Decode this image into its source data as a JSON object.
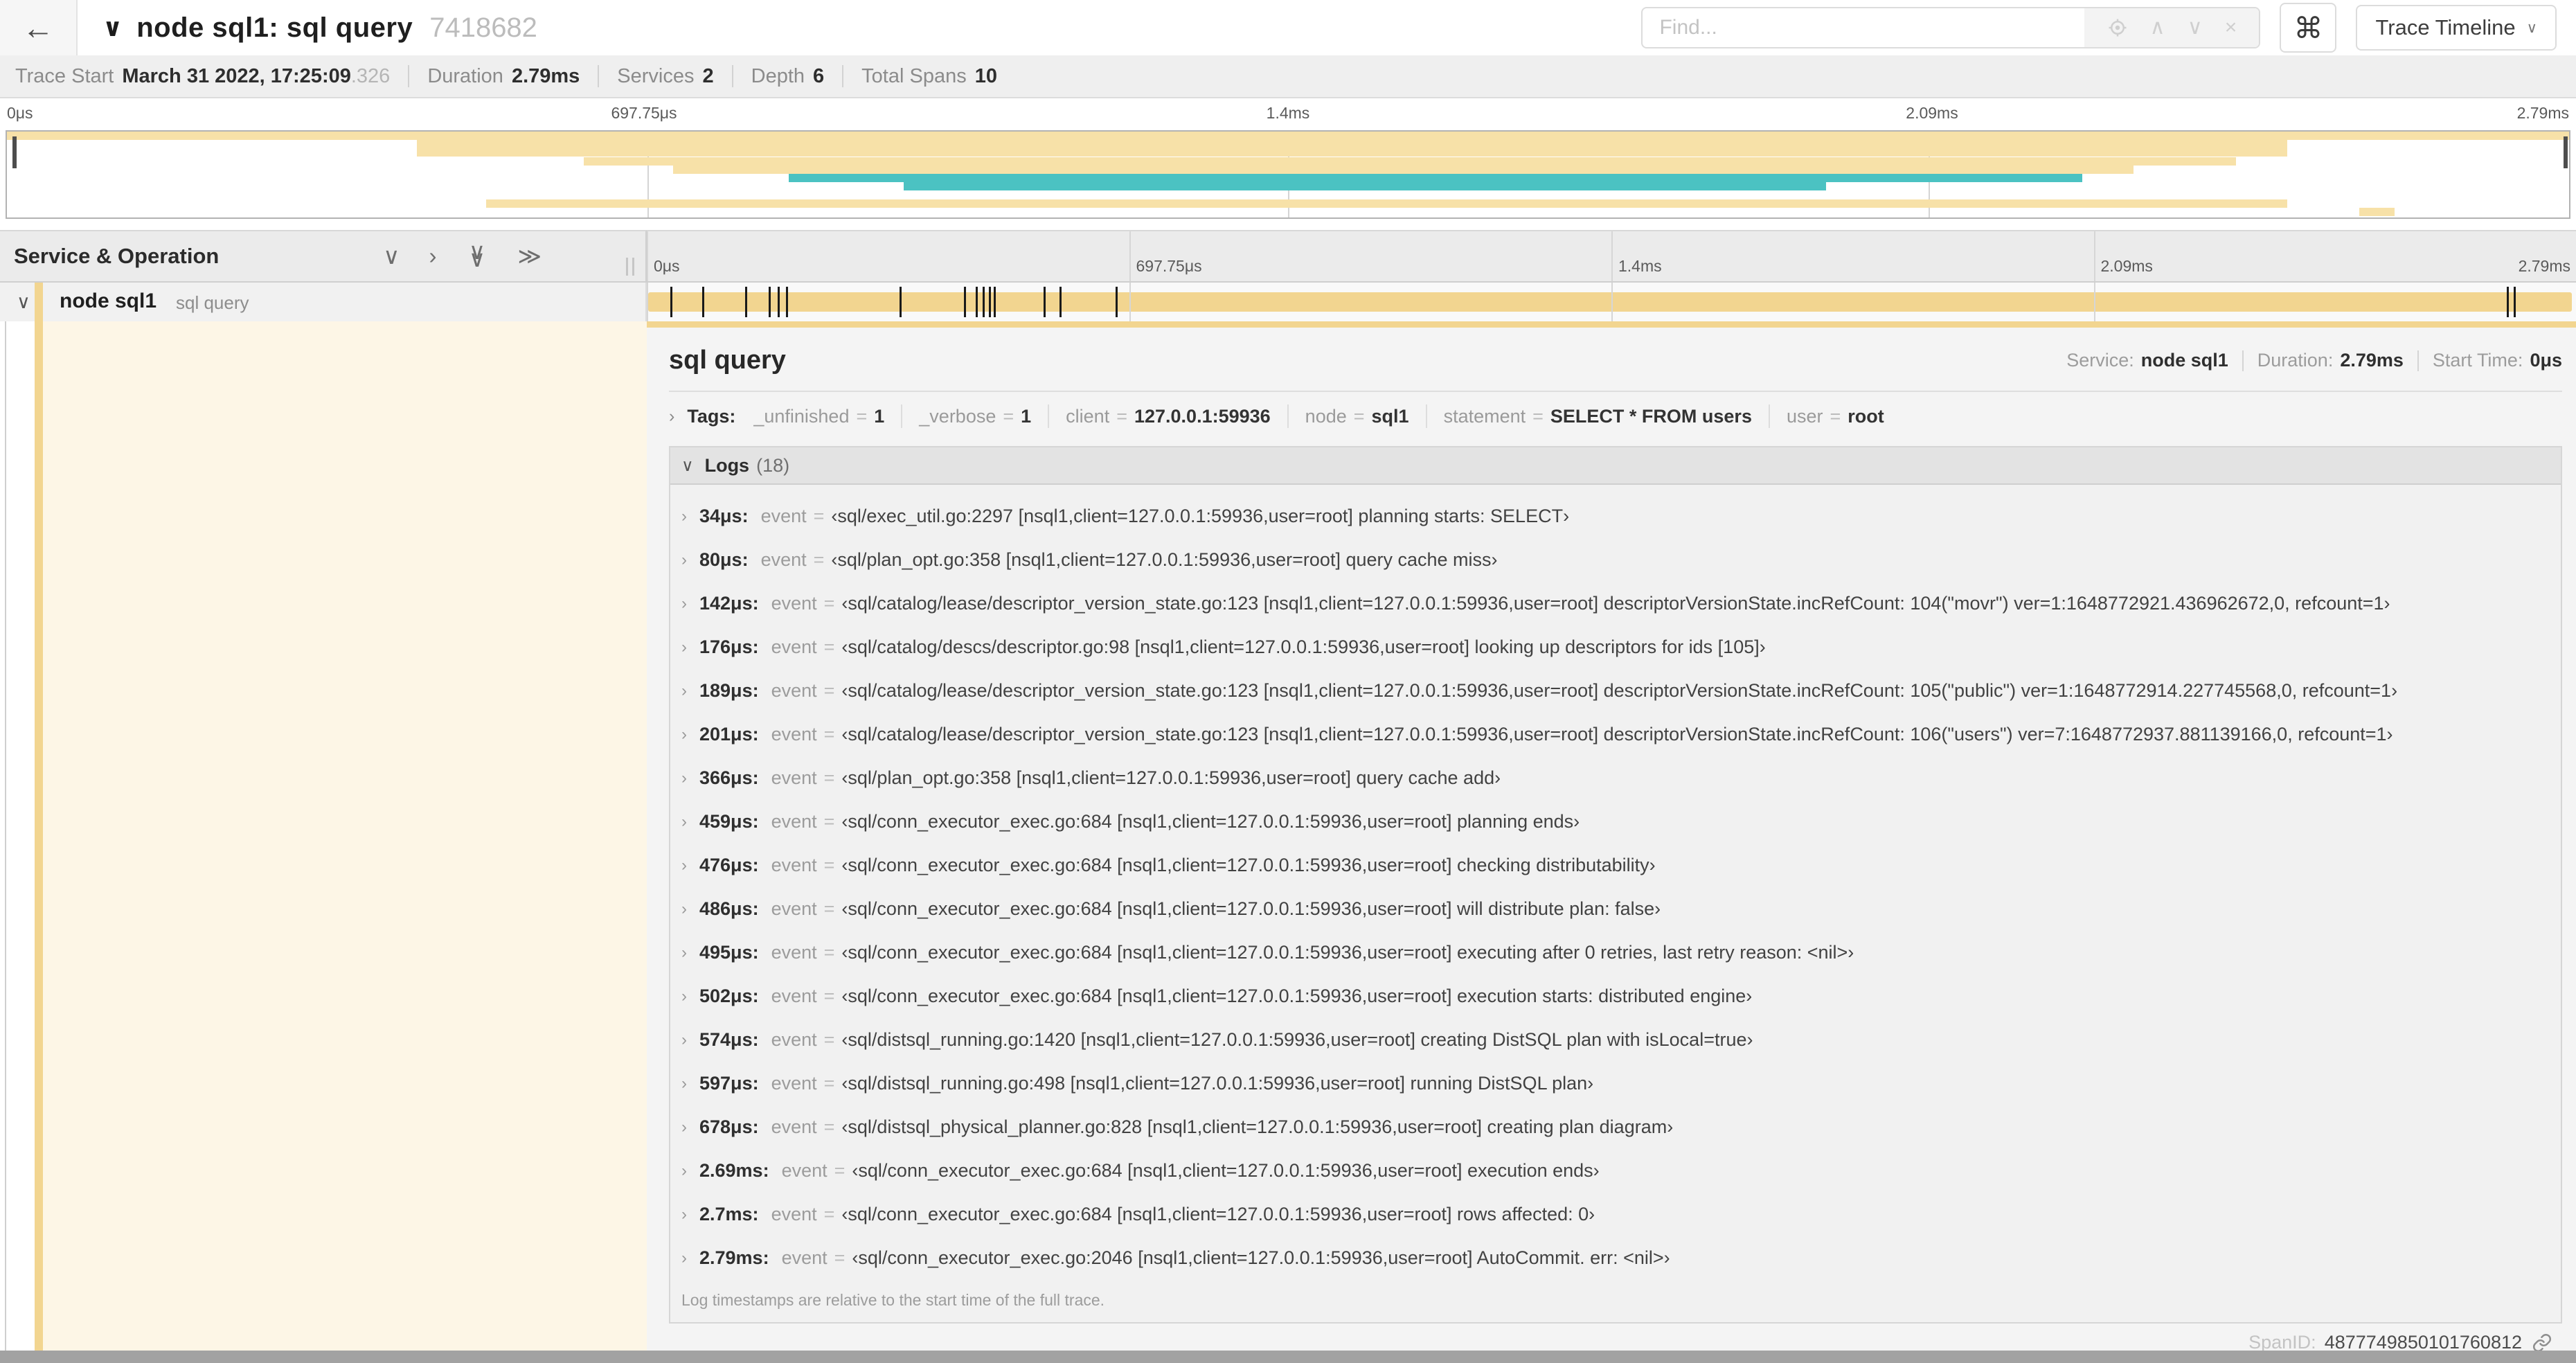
{
  "icons": {
    "back": "←",
    "chevron_down": "∨",
    "chevron_right": "›",
    "double_chevron_right": "≫",
    "chevron_up": "∧",
    "close": "×",
    "command": "⌘"
  },
  "topbar": {
    "title": "node sql1: sql query",
    "trace_id": "7418682",
    "find_placeholder": "Find...",
    "view_button": "Trace Timeline"
  },
  "trace_info": {
    "items": [
      {
        "label": "Trace Start",
        "value": "March 31 2022, 17:25:09",
        "muted": ".326"
      },
      {
        "label": "Duration",
        "value": "2.79ms"
      },
      {
        "label": "Services",
        "value": "2"
      },
      {
        "label": "Depth",
        "value": "6"
      },
      {
        "label": "Total Spans",
        "value": "10"
      }
    ]
  },
  "ruler": {
    "ticks": [
      "0μs",
      "697.75μs",
      "1.4ms",
      "2.09ms",
      "2.79ms"
    ]
  },
  "colors": {
    "tan": "#f2d590",
    "tan_light": "#f7e1a8",
    "teal": "#4bc2c2",
    "cream": "#fdf6e6"
  },
  "minimap": {
    "spans": [
      {
        "row": 0,
        "start": 0,
        "end": 100,
        "color": "tan_light"
      },
      {
        "row": 1,
        "start": 16,
        "end": 89,
        "color": "tan_light"
      },
      {
        "row": 2,
        "start": 16,
        "end": 89,
        "color": "tan_light"
      },
      {
        "row": 3,
        "start": 22.5,
        "end": 87,
        "color": "tan_light"
      },
      {
        "row": 4,
        "start": 26,
        "end": 83,
        "color": "tan_light"
      },
      {
        "row": 5,
        "start": 30.5,
        "end": 81,
        "color": "teal"
      },
      {
        "row": 6,
        "start": 35,
        "end": 71,
        "color": "teal"
      },
      {
        "row": 8,
        "start": 18.7,
        "end": 89,
        "color": "tan_light"
      },
      {
        "row": 9,
        "start": 91.8,
        "end": 93.2,
        "color": "tan_light"
      }
    ]
  },
  "timeline": {
    "header_label": "Service & Operation",
    "row": {
      "service": "node sql1",
      "operation": "sql query"
    },
    "duration_us": 2790,
    "log_marks_us": [
      34,
      80,
      142,
      176,
      189,
      201,
      366,
      459,
      476,
      486,
      495,
      502,
      574,
      597,
      678,
      2690,
      2700,
      2790
    ]
  },
  "detail": {
    "operation": "sql query",
    "meta": {
      "service_label": "Service:",
      "service": "node sql1",
      "duration_label": "Duration:",
      "duration": "2.79ms",
      "start_label": "Start Time:",
      "start": "0μs"
    },
    "tags_label": "Tags:",
    "tags": [
      {
        "key": "_unfinished",
        "value": "1"
      },
      {
        "key": "_verbose",
        "value": "1"
      },
      {
        "key": "client",
        "value": "127.0.0.1:59936"
      },
      {
        "key": "node",
        "value": "sql1"
      },
      {
        "key": "statement",
        "value": "SELECT * FROM users"
      },
      {
        "key": "user",
        "value": "root"
      }
    ],
    "logs_label": "Logs",
    "logs_count": "(18)",
    "logs": [
      {
        "time": "34μs",
        "key": "event",
        "value": "‹sql/exec_util.go:2297 [nsql1,client=127.0.0.1:59936,user=root] planning starts: SELECT›"
      },
      {
        "time": "80μs",
        "key": "event",
        "value": "‹sql/plan_opt.go:358 [nsql1,client=127.0.0.1:59936,user=root] query cache miss›"
      },
      {
        "time": "142μs",
        "key": "event",
        "value": "‹sql/catalog/lease/descriptor_version_state.go:123 [nsql1,client=127.0.0.1:59936,user=root] descriptorVersionState.incRefCount: 104(\"movr\") ver=1:1648772921.436962672,0, refcount=1›"
      },
      {
        "time": "176μs",
        "key": "event",
        "value": "‹sql/catalog/descs/descriptor.go:98 [nsql1,client=127.0.0.1:59936,user=root] looking up descriptors for ids [105]›"
      },
      {
        "time": "189μs",
        "key": "event",
        "value": "‹sql/catalog/lease/descriptor_version_state.go:123 [nsql1,client=127.0.0.1:59936,user=root] descriptorVersionState.incRefCount: 105(\"public\") ver=1:1648772914.227745568,0, refcount=1›"
      },
      {
        "time": "201μs",
        "key": "event",
        "value": "‹sql/catalog/lease/descriptor_version_state.go:123 [nsql1,client=127.0.0.1:59936,user=root] descriptorVersionState.incRefCount: 106(\"users\") ver=7:1648772937.881139166,0, refcount=1›"
      },
      {
        "time": "366μs",
        "key": "event",
        "value": "‹sql/plan_opt.go:358 [nsql1,client=127.0.0.1:59936,user=root] query cache add›"
      },
      {
        "time": "459μs",
        "key": "event",
        "value": "‹sql/conn_executor_exec.go:684 [nsql1,client=127.0.0.1:59936,user=root] planning ends›"
      },
      {
        "time": "476μs",
        "key": "event",
        "value": "‹sql/conn_executor_exec.go:684 [nsql1,client=127.0.0.1:59936,user=root] checking distributability›"
      },
      {
        "time": "486μs",
        "key": "event",
        "value": "‹sql/conn_executor_exec.go:684 [nsql1,client=127.0.0.1:59936,user=root] will distribute plan: false›"
      },
      {
        "time": "495μs",
        "key": "event",
        "value": "‹sql/conn_executor_exec.go:684 [nsql1,client=127.0.0.1:59936,user=root] executing after 0 retries, last retry reason: <nil>›"
      },
      {
        "time": "502μs",
        "key": "event",
        "value": "‹sql/conn_executor_exec.go:684 [nsql1,client=127.0.0.1:59936,user=root] execution starts: distributed engine›"
      },
      {
        "time": "574μs",
        "key": "event",
        "value": "‹sql/distsql_running.go:1420 [nsql1,client=127.0.0.1:59936,user=root] creating DistSQL plan with isLocal=true›"
      },
      {
        "time": "597μs",
        "key": "event",
        "value": "‹sql/distsql_running.go:498 [nsql1,client=127.0.0.1:59936,user=root] running DistSQL plan›"
      },
      {
        "time": "678μs",
        "key": "event",
        "value": "‹sql/distsql_physical_planner.go:828 [nsql1,client=127.0.0.1:59936,user=root] creating plan diagram›"
      },
      {
        "time": "2.69ms",
        "key": "event",
        "value": "‹sql/conn_executor_exec.go:684 [nsql1,client=127.0.0.1:59936,user=root] execution ends›"
      },
      {
        "time": "2.7ms",
        "key": "event",
        "value": "‹sql/conn_executor_exec.go:684 [nsql1,client=127.0.0.1:59936,user=root] rows affected: 0›"
      },
      {
        "time": "2.79ms",
        "key": "event",
        "value": "‹sql/conn_executor_exec.go:2046 [nsql1,client=127.0.0.1:59936,user=root] AutoCommit. err: <nil>›"
      }
    ],
    "logs_note": "Log timestamps are relative to the start time of the full trace.",
    "span_id_label": "SpanID:",
    "span_id": "4877749850101760812"
  }
}
